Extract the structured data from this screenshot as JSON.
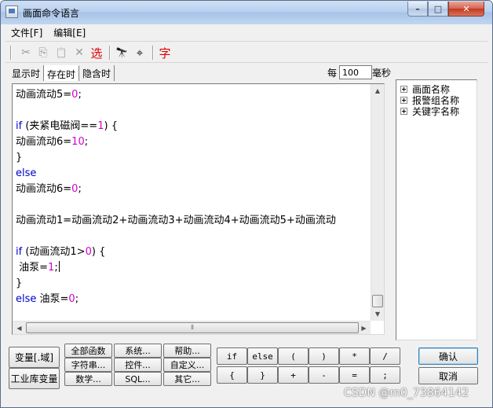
{
  "window": {
    "title": "画面命令语言",
    "controls": {
      "minimize": "–",
      "maximize": "□",
      "close": "✕"
    }
  },
  "menu": [
    "文件[F]",
    "编辑[E]"
  ],
  "toolbar": {
    "icons": [
      "cut-icon",
      "copy-icon",
      "paste-icon",
      "delete-icon",
      "binoculars-icon",
      "replace-icon"
    ],
    "select_label": "选",
    "font_label": "字",
    "glyphs": {
      "cut": "✂",
      "copy": "⎘",
      "paste": "📋",
      "delete": "✕",
      "find": "🔭",
      "replace": "⌖"
    }
  },
  "tabs": [
    "显示时",
    "存在时",
    "隐含时"
  ],
  "active_tab": "存在时",
  "interval": {
    "label": "每",
    "value": "100",
    "unit": "毫秒"
  },
  "code_lines": [
    [
      {
        "t": "动画流动5="
      },
      {
        "t": "0",
        "c": "num"
      },
      {
        "t": ";"
      }
    ],
    [],
    [
      {
        "t": "if",
        "c": "kw"
      },
      {
        "t": " (夹紧电磁阀=="
      },
      {
        "t": "1",
        "c": "num"
      },
      {
        "t": ") {"
      }
    ],
    [
      {
        "t": "动画流动6="
      },
      {
        "t": "10",
        "c": "num"
      },
      {
        "t": ";"
      }
    ],
    [
      {
        "t": "}"
      }
    ],
    [
      {
        "t": "else",
        "c": "kw"
      }
    ],
    [
      {
        "t": "动画流动6="
      },
      {
        "t": "0",
        "c": "num"
      },
      {
        "t": ";"
      }
    ],
    [],
    [
      {
        "t": "动画流动1=动画流动2+动画流动3+动画流动4+动画流动5+动画流动"
      }
    ],
    [],
    [
      {
        "t": "if",
        "c": "kw"
      },
      {
        "t": " (动画流动1>"
      },
      {
        "t": "0",
        "c": "num"
      },
      {
        "t": ") {"
      }
    ],
    [
      {
        "t": " 油泵="
      },
      {
        "t": "1",
        "c": "num"
      },
      {
        "t": ";"
      },
      {
        "caret": true
      }
    ],
    [
      {
        "t": "}"
      }
    ],
    [
      {
        "t": "else",
        "c": "kw"
      },
      {
        "t": " 油泵="
      },
      {
        "t": "0",
        "c": "num"
      },
      {
        "t": ";"
      }
    ]
  ],
  "tree": [
    "画面名称",
    "报警组名称",
    "关键字名称"
  ],
  "buttons": {
    "variable": "变量[.域]",
    "industrial_variable": "工业库变量",
    "all_functions": "全部函数",
    "string": "字符串...",
    "math": "数学...",
    "system": "系统...",
    "control": "控件...",
    "sql": "SQL...",
    "help": "帮助...",
    "custom": "自定义...",
    "other": "其它...",
    "ok": "确认",
    "cancel": "取消"
  },
  "operators_row1": [
    "if",
    "else",
    "(",
    ")",
    "*",
    "/"
  ],
  "operators_row2": [
    "{",
    "}",
    "+",
    "-",
    "=",
    ";"
  ],
  "watermark": "CSDN @m0_73864142"
}
